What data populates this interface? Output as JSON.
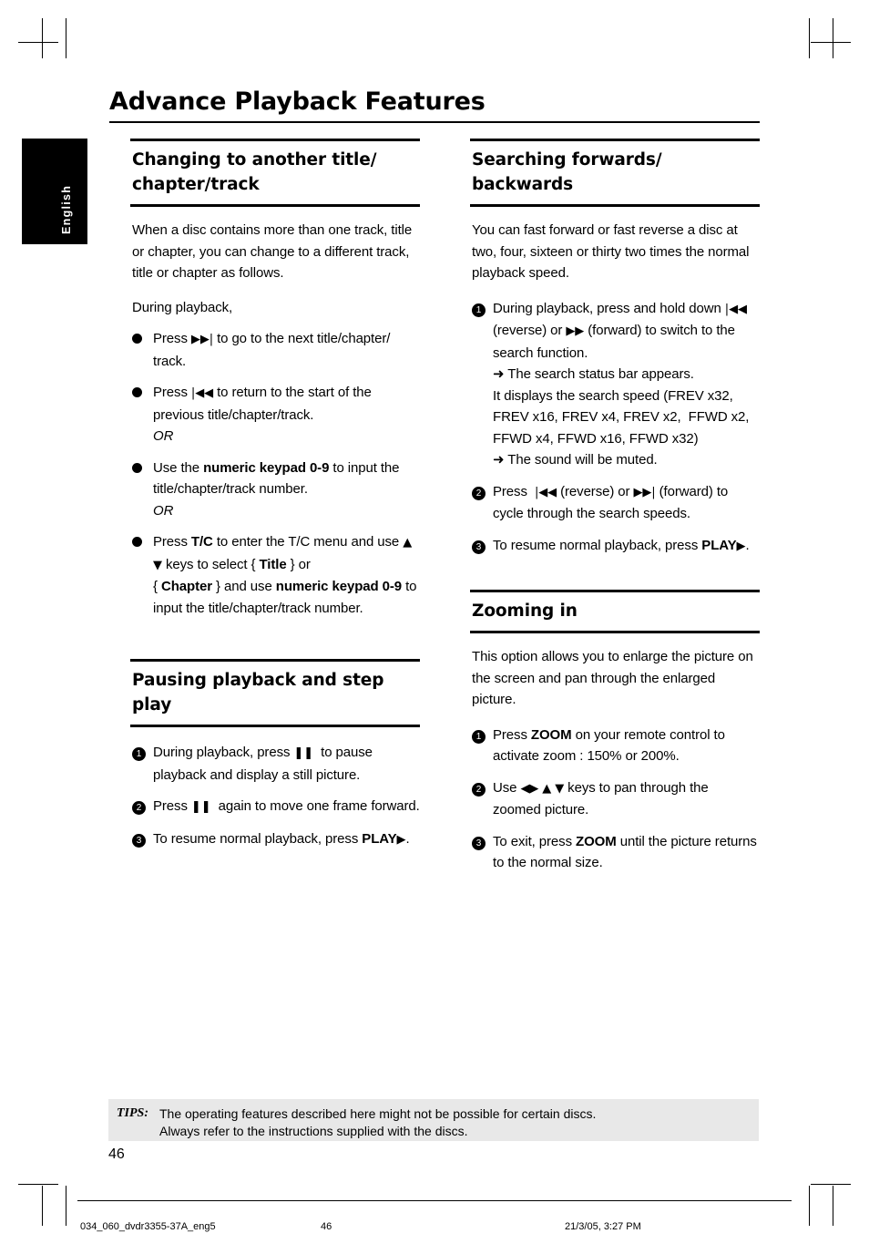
{
  "header": {
    "title": "Advance Playback Features",
    "language_tab": "English"
  },
  "left_column": {
    "section1": {
      "title": "Changing to another title/ chapter/track",
      "intro": "When a disc contains more than one track, title or chapter, you can change to a different track, title or chapter as follows.",
      "subintro": "During playback,",
      "items": [
        {
          "marker": "bullet",
          "text_html": "Press <span class=\"glyph\">▶▶|</span> to go to the next title/chapter/ track."
        },
        {
          "marker": "bullet",
          "text_html": "Press <span class=\"glyph\">|◀◀</span> to return to the start of the previous title/chapter/track.<br><i>OR</i>"
        },
        {
          "marker": "bullet",
          "text_html": "Use the <b>numeric keypad 0-9</b> to input the title/chapter/track number.<br><i>OR</i>"
        },
        {
          "marker": "bullet",
          "text_html": "Press <b>T/C</b> to enter the T/C menu and use <span class=\"glyph\">▲ ▼</span> keys to select { <b>Title</b> } or<br>{ <b>Chapter</b> } and use <b>numeric keypad 0-9</b> to input the title/chapter/track number."
        }
      ]
    },
    "section2": {
      "title": "Pausing playback and step play",
      "items": [
        {
          "marker": "1",
          "text_html": "During playback, press <b class=\"glyph\">❚❚</b>&nbsp; to pause playback and display a still picture."
        },
        {
          "marker": "2",
          "text_html": "Press <b class=\"glyph\">❚❚</b>&nbsp; again to move one frame forward."
        },
        {
          "marker": "3",
          "text_html": "To resume normal playback, press <b>PLAY</b><span class=\"glyph\">▶</span>."
        }
      ]
    }
  },
  "right_column": {
    "section1": {
      "title": "Searching forwards/ backwards",
      "intro": "You can fast forward or fast reverse a disc at two, four, sixteen or thirty two times the normal playback speed.",
      "items": [
        {
          "marker": "1",
          "text_html": "During playback, press and hold down <span class=\"glyph\">|◀◀</span> (reverse) or <span class=\"glyph\">▶▶</span> (forward) to switch to the search function.<br><span class=\"arrow\">➜</span> The search status bar appears.<br>It displays the search speed (FREV x32, FREV x16, FREV x4, FREV x2,&nbsp; FFWD x2, FFWD x4, FFWD x16, FFWD x32)<br><span class=\"arrow\">➜</span> The sound will be muted."
        },
        {
          "marker": "2",
          "text_html": "Press &nbsp;<span class=\"glyph\">|◀◀</span> (reverse) or <span class=\"glyph\">▶▶|</span> (forward) to cycle through the search speeds."
        },
        {
          "marker": "3",
          "text_html": "To resume normal playback, press <b>PLAY</b><span class=\"glyph\">▶</span>."
        }
      ]
    },
    "section2": {
      "title": "Zooming in",
      "intro": "This option allows you to enlarge the picture on the screen and pan through the enlarged picture.",
      "items": [
        {
          "marker": "1",
          "text_html": "Press <b>ZOOM</b> on your remote control to activate zoom : 150% or 200%."
        },
        {
          "marker": "2",
          "text_html": "Use <span class=\"glyph\">◀▶ ▲ ▼</span> keys to pan through the zoomed picture."
        },
        {
          "marker": "3",
          "text_html": "To exit, press <b>ZOOM</b> until the picture returns to the normal size."
        }
      ]
    }
  },
  "tips": {
    "label": "TIPS:",
    "line1": "The operating features described here might not be possible for certain discs.",
    "line2": "Always refer to the instructions supplied with the discs."
  },
  "page_number": "46",
  "footer": {
    "file": "034_060_dvdr3355-37A_eng5",
    "page": "46",
    "date": "21/3/05, 3:27 PM"
  }
}
